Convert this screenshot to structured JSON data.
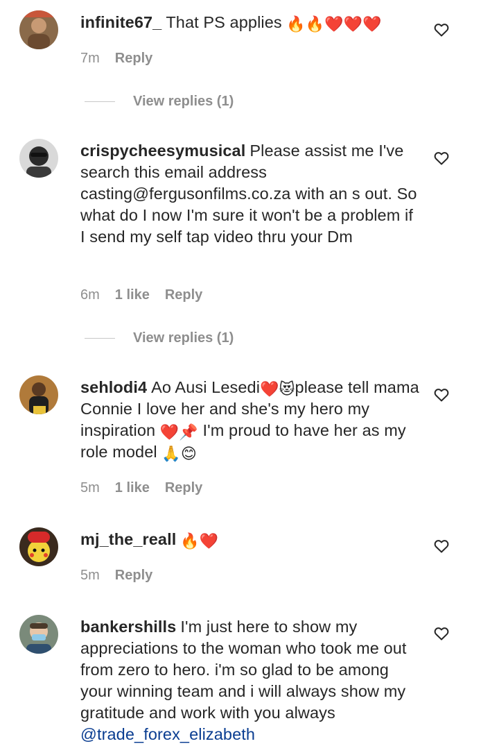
{
  "comments": [
    {
      "username": "infinite67_",
      "text": "That PS applies",
      "emojis": "🔥🔥❤️❤️❤️",
      "time": "7m",
      "likes": "",
      "reply_label": "Reply",
      "view_replies": "View replies (1)"
    },
    {
      "username": "crispycheesymusical",
      "text": "Please assist me I've search this email address casting@fergusonfilms.co.za with an s out. So what do I now I'm sure it won't be a problem if I send my self tap video thru your Dm",
      "time": "6m",
      "likes": "1 like",
      "reply_label": "Reply",
      "view_replies": "View replies (1)"
    },
    {
      "username": "sehlodi4",
      "text_a": "Ao Ausi Lesedi",
      "emoji_a": "❤️😻",
      "text_b": "please tell mama Connie I love her and she's my hero my inspiration",
      "emoji_b": "❤️📌",
      "text_c": "I'm proud to have her as my role model",
      "emoji_c": "🙏😊",
      "time": "5m",
      "likes": "1 like",
      "reply_label": "Reply"
    },
    {
      "username": "mj_the_reall",
      "emojis": "🔥❤️",
      "time": "5m",
      "reply_label": "Reply"
    },
    {
      "username": "bankershills",
      "text": "I'm just here to show my appreciations to the woman who took me out from zero to hero. i'm so glad to be among your winning team and i will always show my gratitude and work with you always",
      "mention": "@trade_forex_elizabeth"
    }
  ],
  "icons": {
    "like": "heart-outline-icon"
  },
  "colors": {
    "text": "#262626",
    "meta": "#8e8e8e",
    "mention": "#0a3d91"
  }
}
